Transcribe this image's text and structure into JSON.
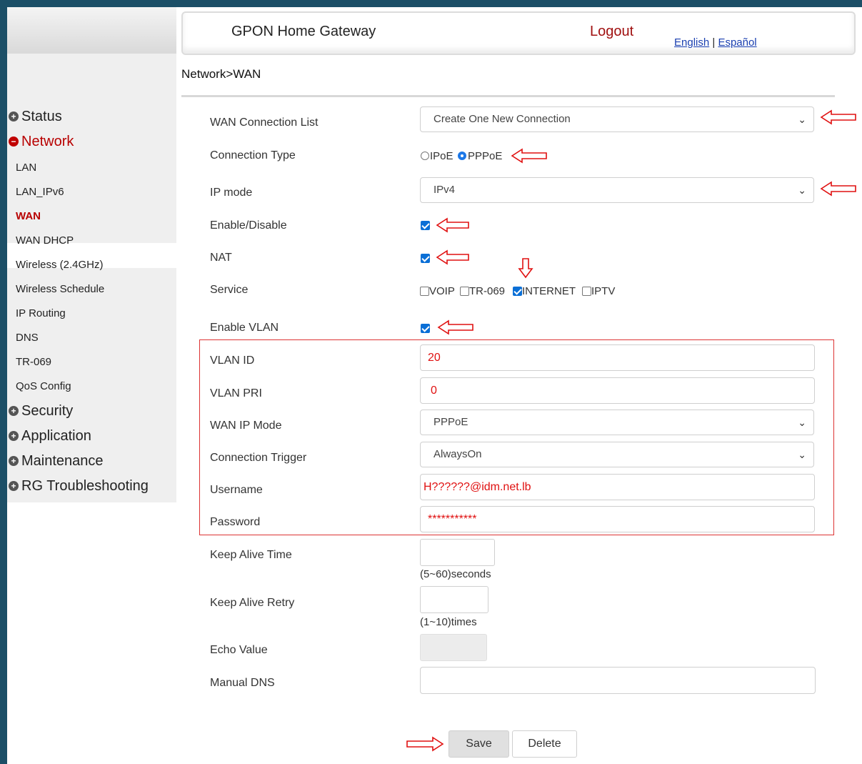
{
  "header": {
    "title": "GPON Home Gateway",
    "logout": "Logout",
    "lang_english": "English",
    "lang_sep": " | ",
    "lang_spanish": "Español"
  },
  "sidebar": {
    "status": "Status",
    "network": "Network",
    "items": [
      "LAN",
      "LAN_IPv6",
      "WAN",
      "WAN DHCP",
      "Wireless (2.4GHz)",
      "Wireless Schedule",
      "IP Routing",
      "DNS",
      "TR-069",
      "QoS Config"
    ],
    "security": "Security",
    "application": "Application",
    "maintenance": "Maintenance",
    "troubleshooting": "RG Troubleshooting"
  },
  "breadcrumb": "Network>WAN",
  "form": {
    "wan_connection_list": {
      "label": "WAN Connection List",
      "value": "Create One New Connection"
    },
    "connection_type": {
      "label": "Connection Type",
      "ipoe": "IPoE",
      "pppoe": "PPPoE",
      "selected": "PPPoE"
    },
    "ip_mode": {
      "label": "IP mode",
      "value": "IPv4"
    },
    "enable_disable": {
      "label": "Enable/Disable",
      "checked": true
    },
    "nat": {
      "label": "NAT",
      "checked": true
    },
    "service": {
      "label": "Service",
      "voip": "VOIP",
      "tr069": "TR-069",
      "internet": "INTERNET",
      "iptv": "IPTV"
    },
    "enable_vlan": {
      "label": "Enable VLAN",
      "checked": true
    },
    "vlan_id": {
      "label": "VLAN ID",
      "value": "20"
    },
    "vlan_pri": {
      "label": "VLAN PRI",
      "value": "0"
    },
    "wan_ip_mode": {
      "label": "WAN IP Mode",
      "value": "PPPoE"
    },
    "connection_trigger": {
      "label": "Connection Trigger",
      "value": "AlwaysOn"
    },
    "username": {
      "label": "Username",
      "value": "H??????@idm.net.lb"
    },
    "password": {
      "label": "Password",
      "value": "***********"
    },
    "keep_alive_time": {
      "label": "Keep Alive Time",
      "hint": "(5~60)seconds"
    },
    "keep_alive_retry": {
      "label": "Keep Alive Retry",
      "hint": "(1~10)times"
    },
    "echo_value": {
      "label": "Echo Value"
    },
    "manual_dns": {
      "label": "Manual DNS"
    }
  },
  "buttons": {
    "save": "Save",
    "delete": "Delete"
  },
  "colors": {
    "accent_red": "#b80000",
    "annotation_red": "#e01010",
    "check_blue": "#0a6fd6",
    "background": "#1c4f67"
  }
}
